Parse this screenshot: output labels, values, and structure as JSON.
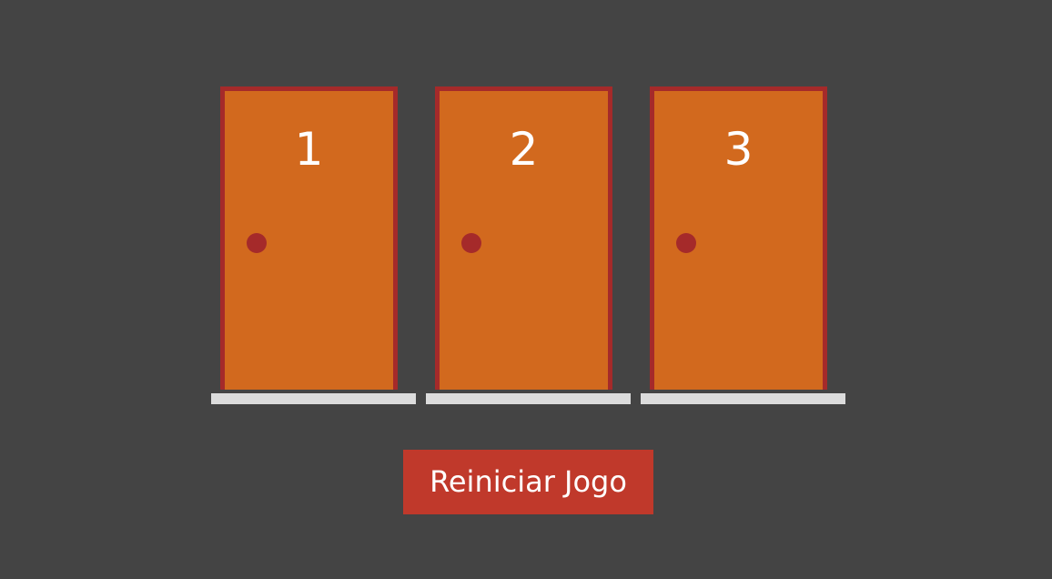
{
  "doors": [
    {
      "number": "1"
    },
    {
      "number": "2"
    },
    {
      "number": "3"
    }
  ],
  "reset_button": {
    "label": "Reiniciar Jogo"
  },
  "colors": {
    "background": "#444444",
    "door_fill": "#d2691e",
    "door_frame": "#a52a2a",
    "knob": "#a52a2a",
    "threshold": "#dcdcdc",
    "button": "#c0392b",
    "text": "#ffffff"
  }
}
